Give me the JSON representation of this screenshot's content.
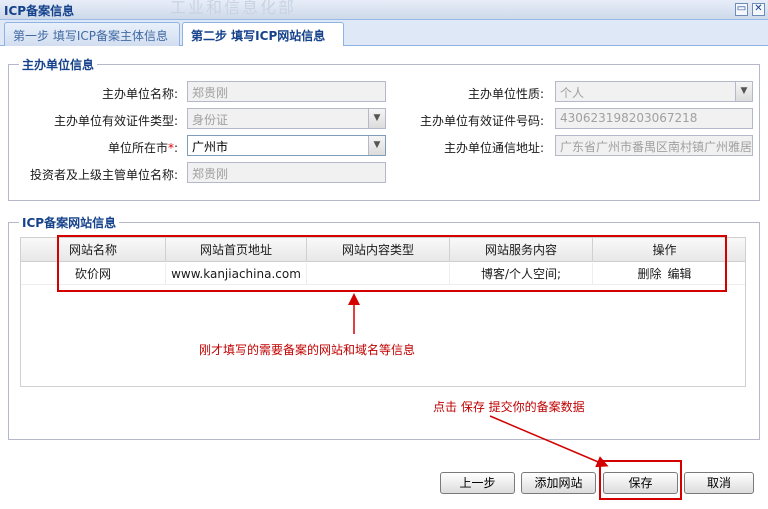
{
  "window": {
    "title": "ICP备案信息",
    "watermark": "工业和信息化部",
    "restore_icon": "restore-icon",
    "close_icon": "close-icon"
  },
  "tabs": [
    {
      "label": "第一步  填写ICP备案主体信息",
      "active": false
    },
    {
      "label": "第二步  填写ICP网站信息",
      "active": true
    }
  ],
  "sponsor": {
    "legend": "主办单位信息",
    "name_label": "主办单位名称:",
    "name_value": "郑贵刚",
    "nature_label": "主办单位性质:",
    "nature_value": "个人",
    "cert_type_label": "主办单位有效证件类型:",
    "cert_type_value": "身份证",
    "cert_no_label": "主办单位有效证件号码:",
    "cert_no_value": "430623198203067218",
    "city_label": "单位所在市",
    "city_required": "*",
    "city_colon": ":",
    "city_value": "广州市",
    "address_label": "主办单位通信地址:",
    "address_value": "广东省广州市番禺区南村镇广州雅居",
    "investor_label": "投资者及上级主管单位名称:",
    "investor_value": "郑贵刚"
  },
  "websites": {
    "legend": "ICP备案网站信息",
    "columns": [
      "网站名称",
      "网站首页地址",
      "网站内容类型",
      "网站服务内容",
      "操作"
    ],
    "rows": [
      {
        "name": "砍价网",
        "url": "www.kanjiachina.com",
        "content_type": "",
        "service": "博客/个人空间;",
        "actions": [
          "删除",
          "编辑"
        ]
      }
    ]
  },
  "annotations": {
    "table_note": "刚才填写的需要备案的网站和域名等信息",
    "save_note": "点击  保存  提交你的备案数据",
    "color": "#d40000"
  },
  "buttons": {
    "prev": "上一步",
    "add_site": "添加网站",
    "save": "保存",
    "cancel": "取消"
  },
  "colors": {
    "header_blue": "#15428b",
    "border_blue": "#99bbe8",
    "annotation_red": "#c00000"
  }
}
